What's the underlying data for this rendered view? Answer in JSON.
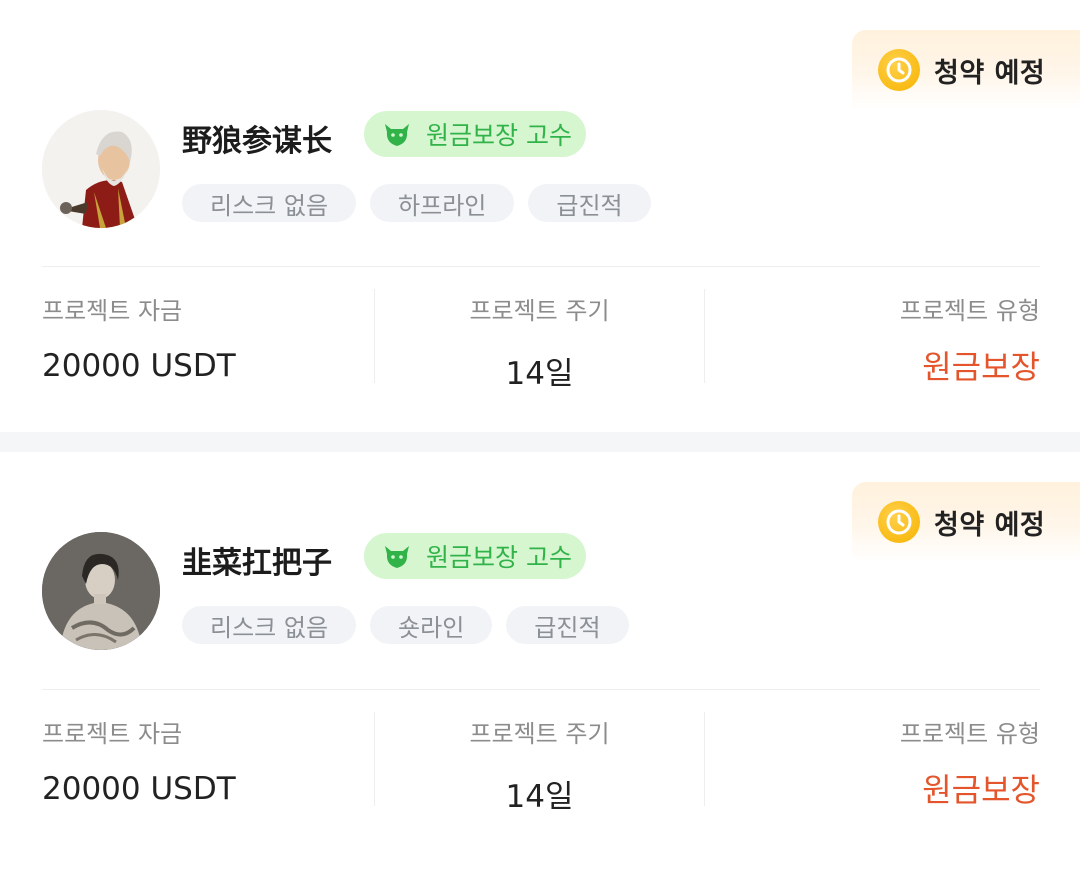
{
  "cards": [
    {
      "status": {
        "label": "청약 예정",
        "icon": "clock-icon",
        "color": "#f6b300"
      },
      "trader": {
        "name": "野狼参谋长",
        "avatar": "avatar-warrior-illustration"
      },
      "type_badge": {
        "label": "원금보장 고수",
        "icon": "bull-icon",
        "color": "#32b34a"
      },
      "tags": [
        "리스크 없음",
        "하프라인",
        "급진적"
      ],
      "stats": [
        {
          "label": "프로젝트 자금",
          "value": "20000 USDT"
        },
        {
          "label": "프로젝트 주기",
          "value": "14일"
        },
        {
          "label": "프로젝트 유형",
          "value": "원금보장",
          "color": "#e4552c"
        }
      ]
    },
    {
      "status": {
        "label": "청약 예정",
        "icon": "clock-icon",
        "color": "#f6b300"
      },
      "trader": {
        "name": "韭菜扛把子",
        "avatar": "avatar-man-photo"
      },
      "type_badge": {
        "label": "원금보장 고수",
        "icon": "bull-icon",
        "color": "#32b34a"
      },
      "tags": [
        "리스크 없음",
        "숏라인",
        "급진적"
      ],
      "stats": [
        {
          "label": "프로젝트 자금",
          "value": "20000 USDT"
        },
        {
          "label": "프로젝트 주기",
          "value": "14일"
        },
        {
          "label": "프로젝트 유형",
          "value": "원금보장",
          "color": "#e4552c"
        }
      ]
    }
  ]
}
